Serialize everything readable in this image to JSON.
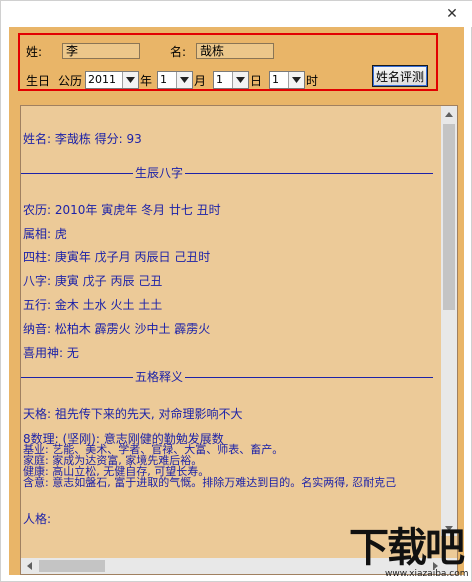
{
  "window": {
    "close_glyph": "✕"
  },
  "form": {
    "surname_label": "姓:",
    "surname_value": "李",
    "name_label": "名:",
    "name_value": "哉栋",
    "birth_label": "生日",
    "calendar_label": "公历",
    "year_value": "2011",
    "year_unit": "年",
    "month_value": "1",
    "month_unit": "月",
    "day_value": "1",
    "day_unit": "日",
    "hour_value": "1",
    "hour_unit": "时",
    "evaluate_button": "姓名评测"
  },
  "result": {
    "summary": "姓名: 李哉栋   得分: 93",
    "section1_title": "生辰八字",
    "lunar": "农历: 2010年  寅虎年 冬月 廿七 丑时",
    "zodiac": "属相: 虎",
    "four_pillars": "四柱: 庚寅年 戊子月 丙辰日 己丑时",
    "bazi": "八字: 庚寅 戊子 丙辰 己丑",
    "five_elements": "五行: 金木 土水 火土 土土",
    "nayin": "纳音: 松柏木 霹雳火 沙中土 霹雳火",
    "favorable_god": "喜用神: 无",
    "section2_title": "五格释义",
    "tian_ge": "天格: 祖先传下来的先天, 对命理影响不大",
    "shuli": "8数理: (坚刚): 意志刚健的勤勉发展数",
    "career": "基业: 艺能、美术、学者、官禄、大富、师表、畜产。",
    "family": "家庭: 家成为达资富, 家境先难后裕。",
    "health": "健康: 高山立松, 无健自存, 可望长寿。",
    "meaning": "含意: 意志如盤石, 富于进取的气慨。排除万难达到目的。名实两得, 忍耐克己",
    "ren_ge": "人格:"
  },
  "watermark": {
    "brand": "下载吧",
    "url": "www.xiazaiba.com"
  }
}
